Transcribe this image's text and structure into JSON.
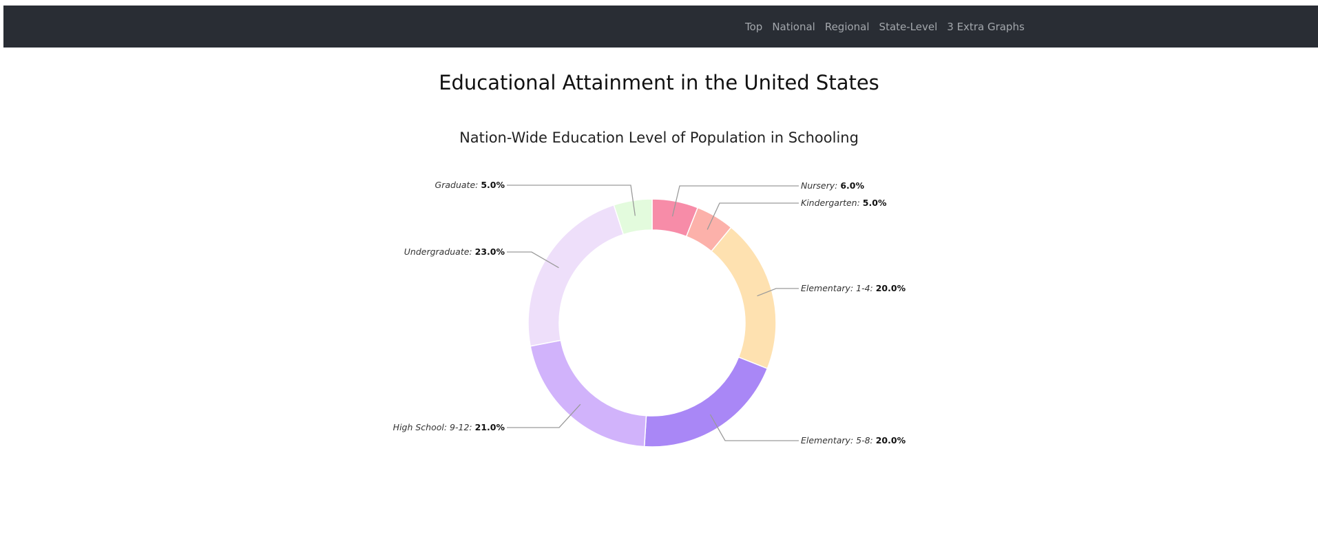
{
  "nav": {
    "items": [
      {
        "label": "Top"
      },
      {
        "label": "National"
      },
      {
        "label": "Regional"
      },
      {
        "label": "State-Level"
      },
      {
        "label": "3 Extra Graphs"
      }
    ]
  },
  "page": {
    "title": "Educational Attainment in the United States"
  },
  "chart_data": {
    "type": "pie",
    "variant": "donut",
    "title": "Nation-Wide Education Level of Population in Schooling",
    "slices": [
      {
        "label": "Nursery",
        "value": 6.0,
        "value_label": "6.0%",
        "color": "#f78ca8"
      },
      {
        "label": "Kindergarten",
        "value": 5.0,
        "value_label": "5.0%",
        "color": "#fcb1aa"
      },
      {
        "label": "Elementary: 1-4",
        "value": 20.0,
        "value_label": "20.0%",
        "color": "#fee1b0"
      },
      {
        "label": "Elementary: 5-8",
        "value": 20.0,
        "value_label": "20.0%",
        "color": "#a987f6"
      },
      {
        "label": "High School: 9-12",
        "value": 21.0,
        "value_label": "21.0%",
        "color": "#d1b3fb"
      },
      {
        "label": "Undergraduate",
        "value": 23.0,
        "value_label": "23.0%",
        "color": "#eedffa"
      },
      {
        "label": "Graduate",
        "value": 5.0,
        "value_label": "5.0%",
        "color": "#e3fbdd"
      }
    ]
  }
}
